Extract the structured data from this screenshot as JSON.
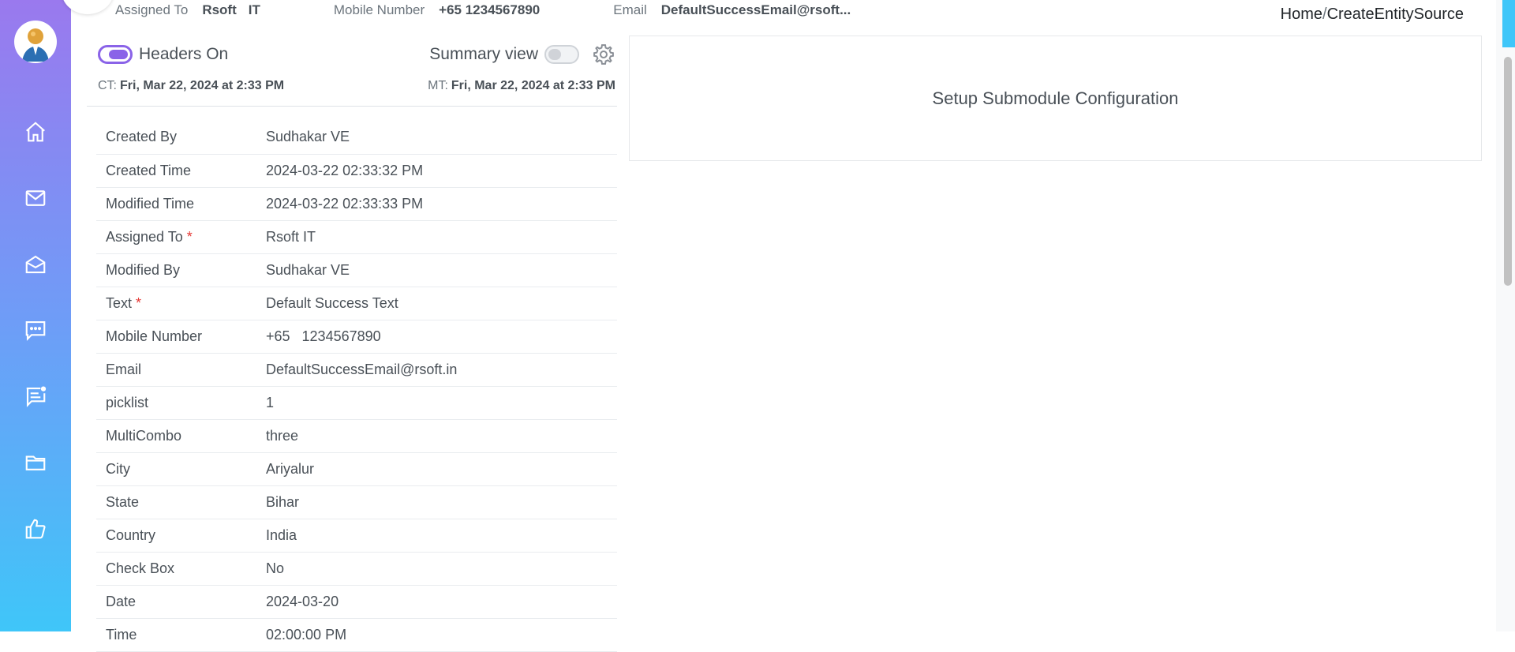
{
  "topbar": {
    "assigned_label": "Assigned To",
    "assigned_value_1": "Rsoft",
    "assigned_value_2": "IT",
    "mobile_label": "Mobile Number",
    "mobile_value": "+65 1234567890",
    "email_label": "Email",
    "email_value": "DefaultSuccessEmail@rsoft..."
  },
  "breadcrumb": {
    "home": "Home",
    "sep": "/",
    "current": "CreateEntitySource"
  },
  "header": {
    "headers_toggle_label": "Headers On",
    "headers_toggle_on": true,
    "summary_label": "Summary view",
    "summary_toggle_on": false
  },
  "meta": {
    "ct_label": "CT:",
    "ct_value": "Fri, Mar 22, 2024 at 2:33 PM",
    "mt_label": "MT:",
    "mt_value": "Fri, Mar 22, 2024 at 2:33 PM"
  },
  "fields": [
    {
      "label": "Created By",
      "value": "Sudhakar VE",
      "required": false
    },
    {
      "label": "Created Time",
      "value": "2024-03-22 02:33:32 PM",
      "required": false
    },
    {
      "label": "Modified Time",
      "value": "2024-03-22 02:33:33 PM",
      "required": false
    },
    {
      "label": "Assigned To",
      "value": "Rsoft IT",
      "required": true
    },
    {
      "label": "Modified By",
      "value": "Sudhakar VE",
      "required": false
    },
    {
      "label": "Text",
      "value": "Default Success Text",
      "required": true
    },
    {
      "label": "Mobile Number",
      "value": "+65   1234567890",
      "required": false
    },
    {
      "label": "Email",
      "value": "DefaultSuccessEmail@rsoft.in",
      "required": false
    },
    {
      "label": "picklist",
      "value": "1",
      "required": false
    },
    {
      "label": "MultiCombo",
      "value": "three",
      "required": false
    },
    {
      "label": "City",
      "value": "Ariyalur",
      "required": false
    },
    {
      "label": "State",
      "value": "Bihar",
      "required": false
    },
    {
      "label": "Country",
      "value": "India",
      "required": false
    },
    {
      "label": "Check Box",
      "value": "No",
      "required": false
    },
    {
      "label": "Date",
      "value": "2024-03-20",
      "required": false
    },
    {
      "label": "Time",
      "value": "02:00:00 PM",
      "required": false
    }
  ],
  "right_panel": {
    "text": "Setup Submodule Configuration"
  },
  "sidebar": {
    "icons": [
      "home-icon",
      "mail-icon",
      "mail-open-icon",
      "chat-icon",
      "notification-chat-icon",
      "folder-icon",
      "thumbs-up-icon"
    ]
  },
  "colors": {
    "accent": "#8a63e8",
    "sidebar_top": "#9a79ee",
    "sidebar_bottom": "#3fc6f9",
    "required": "#e53935"
  }
}
